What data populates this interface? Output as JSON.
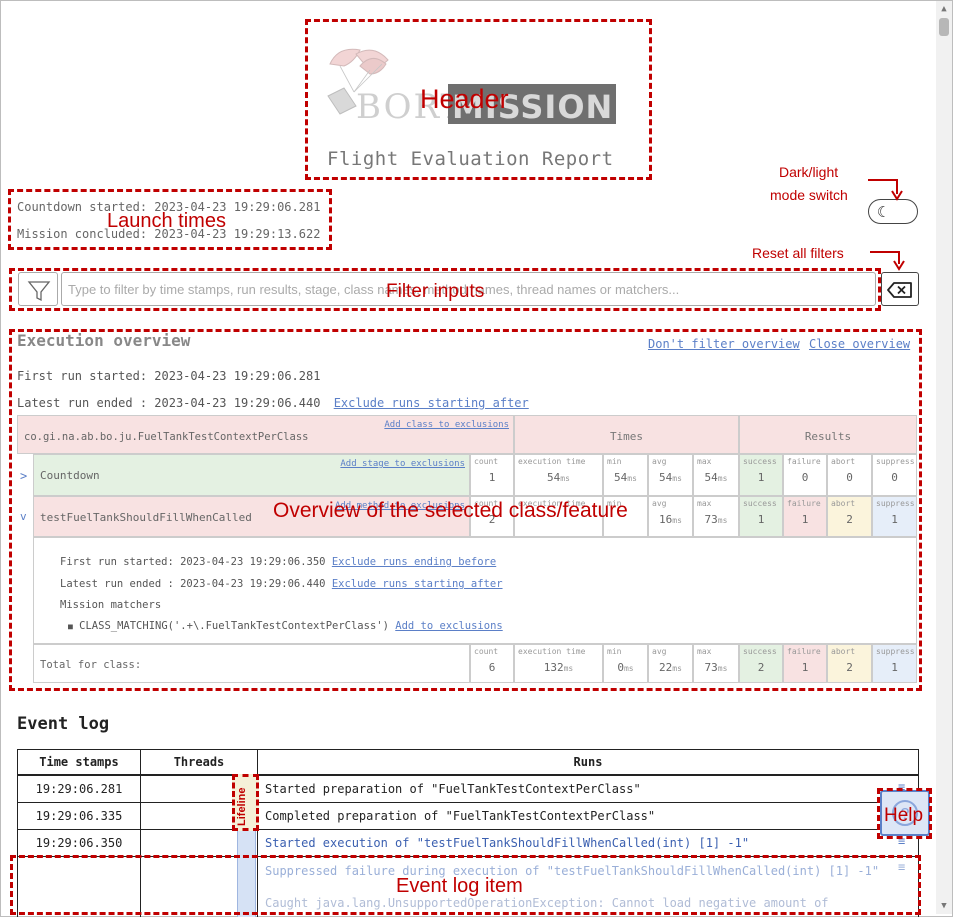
{
  "annotations": {
    "header": "Header",
    "launch_times": "Launch times",
    "dark_light_line1": "Dark/light",
    "dark_light_line2": "mode switch",
    "reset_filters": "Reset all filters",
    "filter_inputs": "Filter inputs",
    "overview": "Overview of the selected class/feature",
    "lifeline": "Lifeline",
    "help": "Help",
    "event_log_item": "Event log item"
  },
  "header": {
    "logo_text_light": "BORT",
    "logo_text_dark": "MISSION",
    "report_title": "Flight Evaluation Report"
  },
  "launch": {
    "countdown_started": "Countdown started: 2023-04-23 19:29:06.281",
    "mission_concluded": "Mission concluded: 2023-04-23 19:29:13.622"
  },
  "filter": {
    "placeholder": "Type to filter by time stamps, run results, stage, class names, method names, thread names or matchers..."
  },
  "overview": {
    "title": "Execution overview",
    "dont_filter_link": "Don't filter overview",
    "close_link": "Close overview",
    "first_run_label": "First run started: ",
    "first_run_value": "2023-04-23 19:29:06.281",
    "latest_run_label": "Latest run ended : ",
    "latest_run_value": "2023-04-23 19:29:06.440",
    "exclude_after_link": "Exclude runs starting after",
    "class_name": "co.gi.na.ab.bo.ju.FuelTankTestContextPerClass",
    "add_class_link": "Add class to exclusions",
    "times_header": "Times",
    "results_header": "Results",
    "rows": [
      {
        "expander": ">",
        "name": "Countdown",
        "exclude_link": "Add stage to exclusions",
        "count": "1",
        "exec": "54",
        "min": "54",
        "avg": "54",
        "max": "54",
        "success": "1",
        "failure": "0",
        "abort": "0",
        "suppress": "0"
      },
      {
        "expander": "v",
        "name": "testFuelTankShouldFillWhenCalled",
        "exclude_link": "Add method to exclusions",
        "count": "2",
        "exec": "",
        "min": "",
        "avg": "16",
        "max": "73",
        "success": "1",
        "failure": "1",
        "abort": "2",
        "suppress": "1"
      }
    ],
    "detail": {
      "first_run_label": "First run started: ",
      "first_run_value": "2023-04-23 19:29:06.350",
      "exclude_before_link": "Exclude runs ending before",
      "latest_run_label": "Latest run ended : ",
      "latest_run_value": "2023-04-23 19:29:06.440",
      "exclude_after_link": "Exclude runs starting after",
      "matchers_label": "Mission matchers",
      "matcher": "CLASS_MATCHING('.+\\.FuelTankTestContextPerClass')",
      "add_exclusion_link": "Add to exclusions"
    },
    "total": {
      "label": "Total for class:",
      "count": "6",
      "exec": "132",
      "min": "0",
      "avg": "22",
      "max": "73",
      "success": "2",
      "failure": "1",
      "abort": "2",
      "suppress": "1"
    },
    "stat_labels": {
      "count": "count",
      "exec": "execution time",
      "min": "min",
      "avg": "avg",
      "max": "max",
      "success": "success",
      "failure": "failure",
      "abort": "abort",
      "suppress": "suppress"
    },
    "unit": "ms"
  },
  "event_log": {
    "title": "Event log",
    "headers": {
      "time": "Time stamps",
      "threads": "Threads",
      "runs": "Runs"
    },
    "rows": [
      {
        "time": "19:29:06.281",
        "run": "Started preparation of \"FuelTankTestContextPerClass\""
      },
      {
        "time": "19:29:06.335",
        "run": "Completed preparation of \"FuelTankTestContextPerClass\""
      },
      {
        "time": "19:29:06.350",
        "run": "Started execution of \"testFuelTankShouldFillWhenCalled(int) [1] -1\""
      },
      {
        "time": "",
        "run": "Suppressed failure during execution of \"testFuelTankShouldFillWhenCalled(int) [1] -1\""
      }
    ],
    "partial_line": "Caught java.lang.UnsupportedOperationException: Cannot load negative amount of"
  },
  "colors": {
    "annotation": "#c00000",
    "link": "#5b7fc7",
    "pink": "#f8e2e2",
    "green": "#e4f1e2"
  }
}
